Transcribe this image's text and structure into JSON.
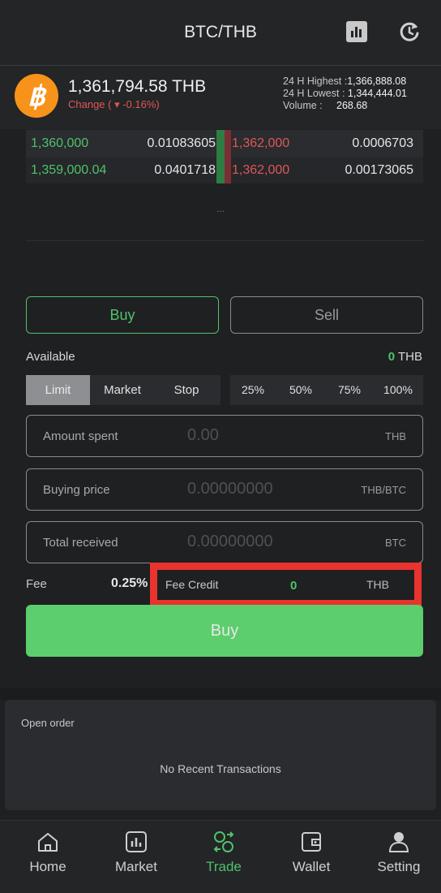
{
  "header": {
    "pair": "BTC/THB",
    "coin_symbol": "฿",
    "price": "1,361,794.58 THB",
    "change": "Change ( ▾ -0.16%)",
    "stats": [
      {
        "label": "24 H Highest :",
        "value": "1,366,888.08"
      },
      {
        "label": "24 H Lowest :",
        "value": "1,344,444.01"
      },
      {
        "label": "Volume :",
        "value": "268.68"
      }
    ],
    "icons": [
      "bar-chart-icon",
      "refresh-icon"
    ]
  },
  "order_book": {
    "rows": [
      {
        "bid_price": "1,360,000",
        "bid_amount": "0.01083605",
        "ask_price": "1,362,000",
        "ask_amount": "0.0006703"
      },
      {
        "bid_price": "1,359,000.04",
        "bid_amount": "0.0401718",
        "ask_price": "1,362,000",
        "ask_amount": "0.00173065"
      }
    ],
    "more": "..."
  },
  "trade": {
    "tabs": [
      "Buy",
      "Sell"
    ],
    "available_label": "Available",
    "available_value": "0",
    "available_unit": "THB",
    "order_types": [
      "Limit",
      "Market",
      "Stop"
    ],
    "selected_order_type": "Limit",
    "percentages": [
      "25%",
      "50%",
      "75%",
      "100%"
    ],
    "fields": [
      {
        "label": "Amount spent",
        "value": "0.00",
        "unit": "THB"
      },
      {
        "label": "Buying price",
        "value": "0.00000000",
        "unit": "THB/BTC"
      },
      {
        "label": "Total received",
        "value": "0.00000000",
        "unit": "BTC"
      }
    ],
    "fee_label": "Fee",
    "fee_value": "0.25%",
    "fee_credit_label": "Fee Credit",
    "fee_credit_value": "0",
    "fee_credit_unit": "THB",
    "submit_label": "Buy"
  },
  "open_orders": {
    "title": "Open order",
    "empty": "No Recent Transactions"
  },
  "nav": {
    "items": [
      {
        "label": "Home",
        "icon": "home-icon"
      },
      {
        "label": "Market",
        "icon": "market-icon"
      },
      {
        "label": "Trade",
        "icon": "trade-icon"
      },
      {
        "label": "Wallet",
        "icon": "wallet-icon"
      },
      {
        "label": "Setting",
        "icon": "user-icon"
      }
    ],
    "active": "Trade"
  },
  "colors": {
    "green": "#4fc26a",
    "red": "#e05656",
    "highlight": "#e8332f",
    "buy_button": "#5cce6d"
  }
}
